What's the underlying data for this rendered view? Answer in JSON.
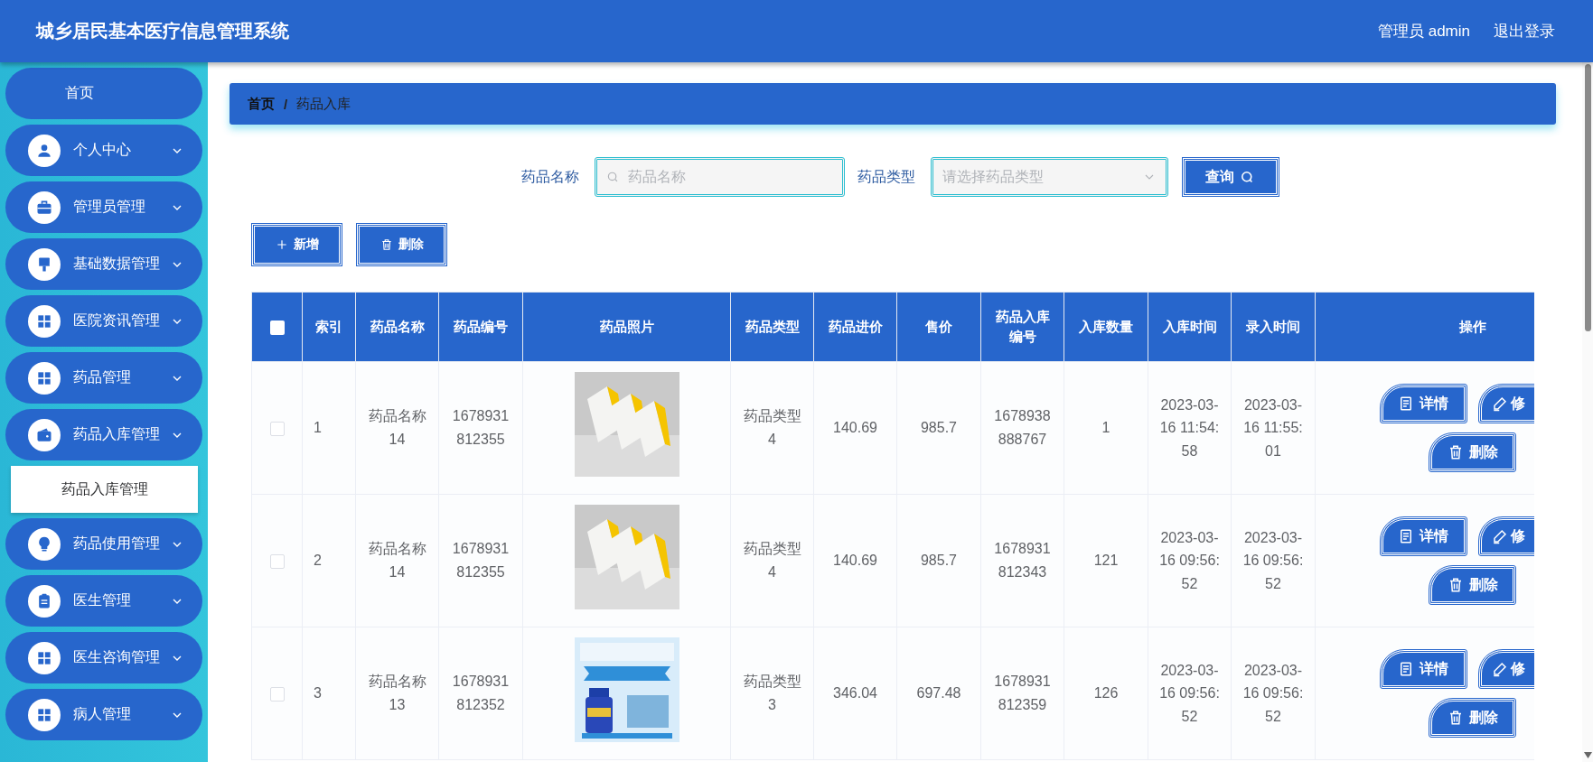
{
  "header": {
    "title": "城乡居民基本医疗信息管理系统",
    "user": "管理员 admin",
    "logout": "退出登录"
  },
  "sidebar": {
    "items": [
      {
        "label": "首页",
        "selected": false
      },
      {
        "label": "个人中心",
        "selected": false
      },
      {
        "label": "管理员管理",
        "selected": false
      },
      {
        "label": "基础数据管理",
        "selected": false
      },
      {
        "label": "医院资讯管理",
        "selected": false
      },
      {
        "label": "药品管理",
        "selected": false
      },
      {
        "label": "药品入库管理",
        "selected": false,
        "children": [
          {
            "label": "药品入库管理",
            "selected": true
          }
        ]
      },
      {
        "label": "药品使用管理",
        "selected": false
      },
      {
        "label": "医生管理",
        "selected": false
      },
      {
        "label": "医生咨询管理",
        "selected": false
      },
      {
        "label": "病人管理",
        "selected": false
      }
    ]
  },
  "breadcrumb": {
    "items": [
      "首页",
      "药品入库"
    ],
    "separator": "/"
  },
  "search": {
    "fields": [
      {
        "kind": "text",
        "label": "药品名称",
        "placeholder": "药品名称"
      },
      {
        "kind": "select",
        "label": "药品类型",
        "placeholder": "请选择药品类型"
      }
    ],
    "button": "查询"
  },
  "actions": [
    {
      "kind": "add",
      "label": "新增"
    },
    {
      "kind": "delete",
      "label": "删除"
    }
  ],
  "table": {
    "select_all": {
      "checked": false
    },
    "columns": [
      "索引",
      "药品名称",
      "药品编号",
      "药品照片",
      "药品类型",
      "药品进价",
      "售价",
      "药品入库编号",
      "入库数量",
      "入库时间",
      "录入时间",
      "操作"
    ],
    "rows": [
      {
        "checked": false,
        "cells": [
          "1",
          "药品名称14",
          "1678931812355",
          null,
          "药品类型4",
          "140.69",
          "985.7",
          "1678938888767",
          "1",
          "2023-03-16 11:54:58",
          "2023-03-16 11:55:01"
        ],
        "actions": [
          {
            "kind": "detail",
            "label": "详情"
          },
          {
            "kind": "edit",
            "label": "修"
          },
          {
            "kind": "delete",
            "label": "删除"
          }
        ]
      },
      {
        "checked": false,
        "cells": [
          "2",
          "药品名称14",
          "1678931812355",
          null,
          "药品类型4",
          "140.69",
          "985.7",
          "1678931812343",
          "121",
          "2023-03-16 09:56:52",
          "2023-03-16 09:56:52"
        ],
        "actions": [
          {
            "kind": "detail",
            "label": "详情"
          },
          {
            "kind": "edit",
            "label": "修"
          },
          {
            "kind": "delete",
            "label": "删除"
          }
        ]
      },
      {
        "checked": false,
        "cells": [
          "3",
          "药品名称13",
          "1678931812352",
          null,
          "药品类型3",
          "346.04",
          "697.48",
          "1678931812359",
          "126",
          "2023-03-16 09:56:52",
          "2023-03-16 09:56:52"
        ],
        "actions": [
          {
            "kind": "detail",
            "label": "详情"
          },
          {
            "kind": "edit",
            "label": "修"
          },
          {
            "kind": "delete",
            "label": "删除"
          }
        ]
      }
    ]
  }
}
